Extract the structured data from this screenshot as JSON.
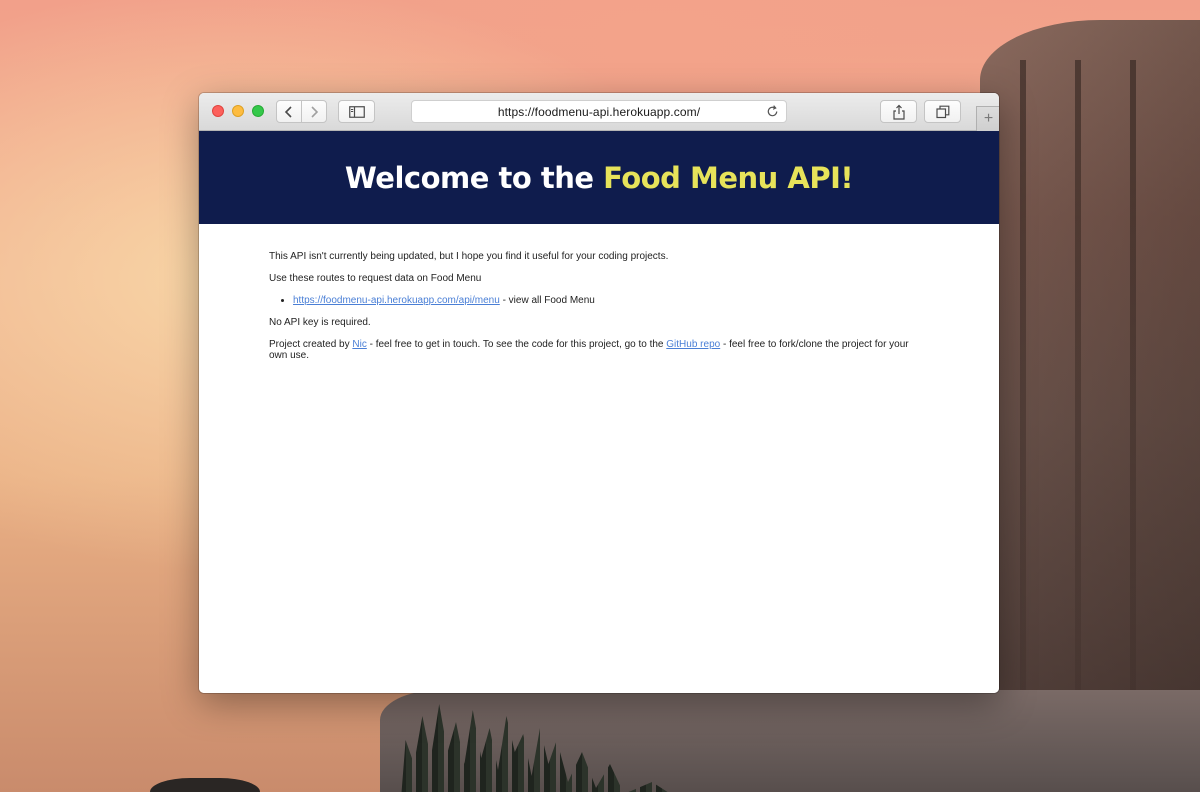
{
  "browser": {
    "url": "https://foodmenu-api.herokuapp.com/",
    "new_tab_symbol": "+",
    "icons": {
      "back": "chevron-left-icon",
      "forward": "chevron-right-icon",
      "sidebar": "sidebar-icon",
      "reload": "reload-icon",
      "share": "share-icon",
      "tabs": "tabs-overview-icon"
    }
  },
  "page": {
    "heading_prefix": "Welcome to the ",
    "heading_highlight": "Food Menu API!",
    "intro": "This API isn't currently being updated, but I hope you find it useful for your coding projects.",
    "routes_intro": "Use these routes to request data on Food Menu",
    "routes": [
      {
        "link": "https://foodmenu-api.herokuapp.com/api/menu",
        "description": " - view all Food Menu"
      }
    ],
    "api_key_note": "No API key is required.",
    "credit_prefix": "Project created by ",
    "credit_author": "Nic",
    "credit_middle": " - feel free to get in touch. To see the code for this project, go to the ",
    "credit_repo": "GitHub repo",
    "credit_suffix": " - feel free to fork/clone the project for your own use."
  },
  "colors": {
    "header_bg": "#0f1c4d",
    "header_text": "#ffffff",
    "accent": "#e7e35a",
    "link": "#4a7fd6"
  }
}
